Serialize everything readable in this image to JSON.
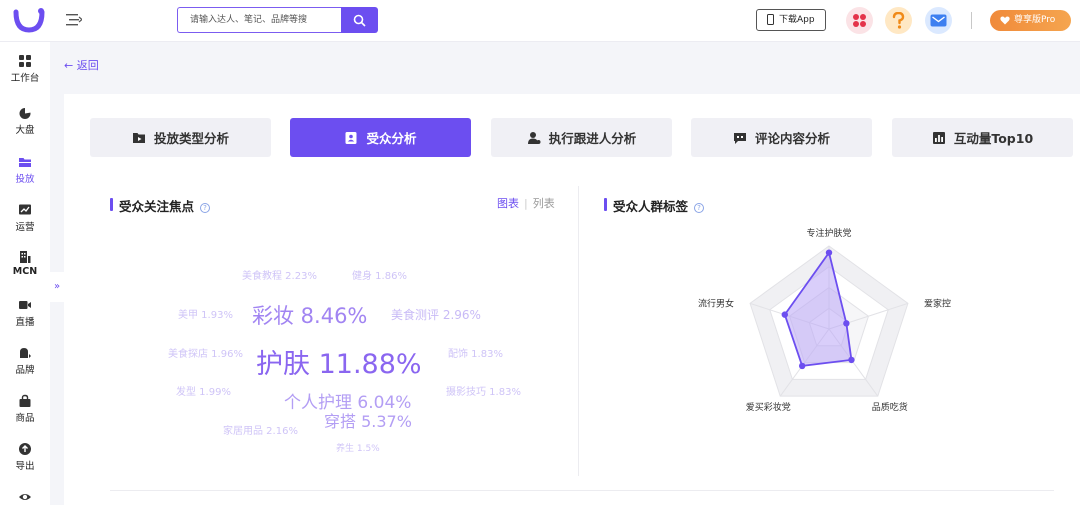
{
  "header": {
    "search_placeholder": "请输入达人、笔记、品牌等搜",
    "download_label": "下载App",
    "pro_label": "尊享版Pro"
  },
  "sidebar": {
    "items": [
      {
        "label": "工作台",
        "icon": "grid-icon",
        "active": false
      },
      {
        "label": "大盘",
        "icon": "pie-chart-icon",
        "active": false
      },
      {
        "label": "投放",
        "icon": "folder-icon",
        "active": true
      },
      {
        "label": "运营",
        "icon": "trend-chart-icon",
        "active": false
      },
      {
        "label": "MCN",
        "icon": "building-icon",
        "active": false
      },
      {
        "label": "直播",
        "icon": "video-camera-icon",
        "active": false
      },
      {
        "label": "品牌",
        "icon": "brand-icon",
        "active": false
      },
      {
        "label": "商品",
        "icon": "shopping-bag-icon",
        "active": false
      },
      {
        "label": "导出",
        "icon": "export-icon",
        "active": false
      },
      {
        "label": "",
        "icon": "eye-icon",
        "active": false
      }
    ],
    "collapse_glyph": "»"
  },
  "back_label": "返回",
  "tabs": [
    {
      "label": "投放类型分析",
      "icon": "folder-play-icon",
      "active": false
    },
    {
      "label": "受众分析",
      "icon": "id-card-icon",
      "active": true
    },
    {
      "label": "执行跟进人分析",
      "icon": "user-icon",
      "active": false
    },
    {
      "label": "评论内容分析",
      "icon": "comment-icon",
      "active": false
    },
    {
      "label": "互动量Top10",
      "icon": "bar-chart-icon",
      "active": false
    }
  ],
  "focus_section": {
    "title": "受众关注焦点",
    "view_chart": "图表",
    "view_list": "列表",
    "words": [
      {
        "text": "美食教程 2.23%",
        "size": "small"
      },
      {
        "text": "健身 1.86%",
        "size": "small"
      },
      {
        "text": "美甲 1.93%",
        "size": "small"
      },
      {
        "text": "彩妆 8.46%",
        "size": "large"
      },
      {
        "text": "美食测评 2.96%",
        "size": "medium"
      },
      {
        "text": "美食探店 1.96%",
        "size": "small"
      },
      {
        "text": "护肤 11.88%",
        "size": "xlarge"
      },
      {
        "text": "配饰 1.83%",
        "size": "small"
      },
      {
        "text": "发型 1.99%",
        "size": "small"
      },
      {
        "text": "个人护理 6.04%",
        "size": "large"
      },
      {
        "text": "摄影技巧 1.83%",
        "size": "small"
      },
      {
        "text": "家居用品 2.16%",
        "size": "small"
      },
      {
        "text": "穿搭 5.37%",
        "size": "large"
      },
      {
        "text": "养生 1.5%",
        "size": "small"
      }
    ]
  },
  "crowd_section": {
    "title": "受众人群标签"
  },
  "colors": {
    "accent": "#6c4ef0",
    "radar_fill": "#b9a6f5",
    "word_light": "#cfc4f7",
    "word_strong": "#9b7cf2"
  },
  "chart_data": {
    "type": "radar",
    "axes": [
      "专注护肤党",
      "爱家控",
      "品质吃货",
      "爱买彩妆党",
      "流行男女"
    ],
    "values": [
      0.92,
      0.22,
      0.46,
      0.55,
      0.56
    ],
    "range": [
      0,
      1
    ],
    "levels": 4
  }
}
